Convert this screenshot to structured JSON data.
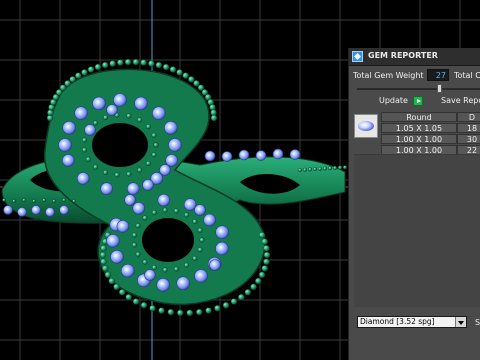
{
  "panel": {
    "title": "GEM REPORTER",
    "total_weight_label": "Total Gem Weight",
    "total_weight_value": "27",
    "total_cost_label": "Total C",
    "update_label": "Update",
    "save_report_label": "Save Repo",
    "table": {
      "columns": [
        "Round",
        "D"
      ],
      "rows": [
        [
          "1.05 X 1.05",
          "18"
        ],
        [
          "1.00 X 1.00",
          "30"
        ],
        [
          "1.00 X 1.00",
          "22"
        ]
      ]
    },
    "material": "Diamond   [3.52 spg]",
    "material_side_label": "S"
  },
  "colors": {
    "viewport_bg": "#000000",
    "grid": "#3a3a3a",
    "axis_x": "#c0392b",
    "axis_y": "#3fa7c9",
    "metal": "#1f8a5a",
    "gem": "#8fb0ff",
    "panel_bg": "#4a4a4a"
  }
}
